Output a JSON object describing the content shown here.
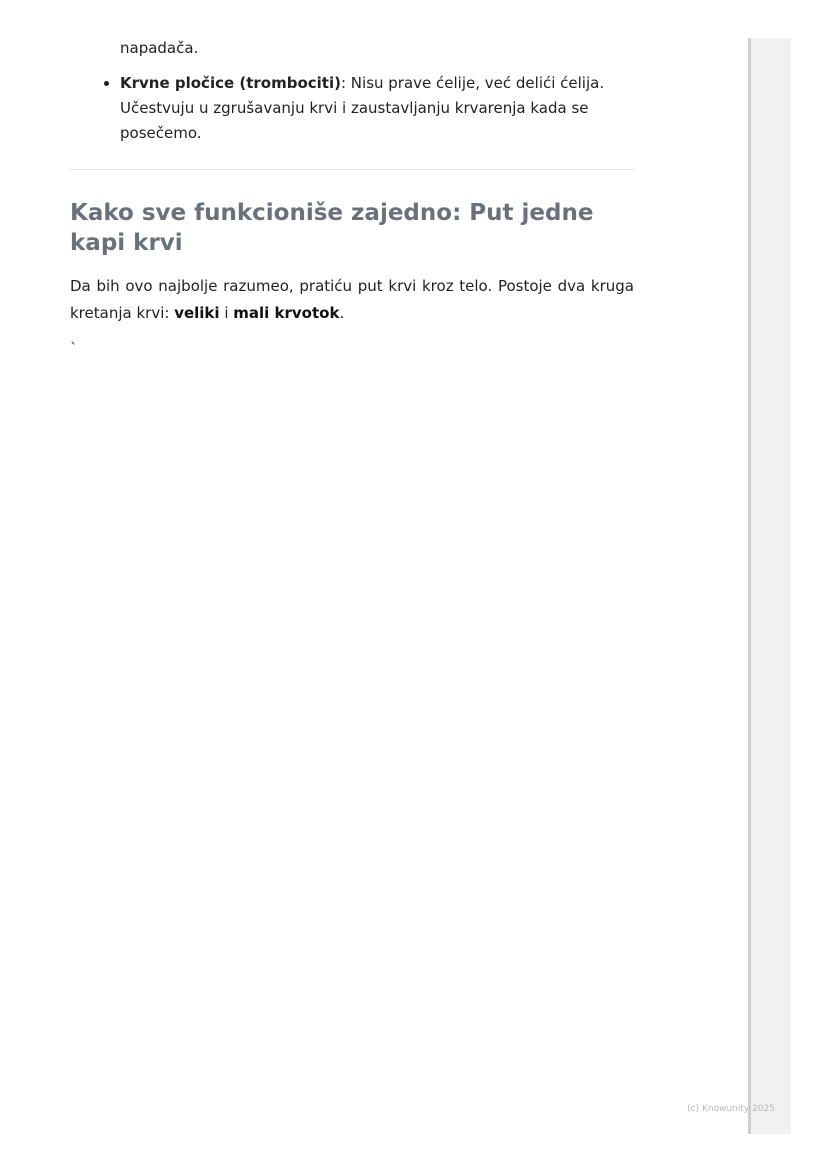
{
  "document": {
    "continued_text": "napadača.",
    "bullets": [
      {
        "term": "Krvne pločice (trombociti)",
        "text": ": Nisu prave ćelije, već delići ćelija. Učestvuju u zgrušavanju krvi i zaustavljanju krvarenja kada se posečemo."
      }
    ],
    "section_title": "Kako sve funkcioniše zajedno: Put jedne kapi krvi",
    "intro": {
      "part1": "Da bih ovo najbolje razumeo, pratiću put krvi kroz telo. Postoje dva kruga kretanja krvi: ",
      "bold1": "veliki",
      "part2": " i ",
      "bold2": "mali krvotok",
      "part3": "."
    },
    "stray_char": "`"
  },
  "footer": {
    "copyright": "(c) Knowunity 2025"
  }
}
